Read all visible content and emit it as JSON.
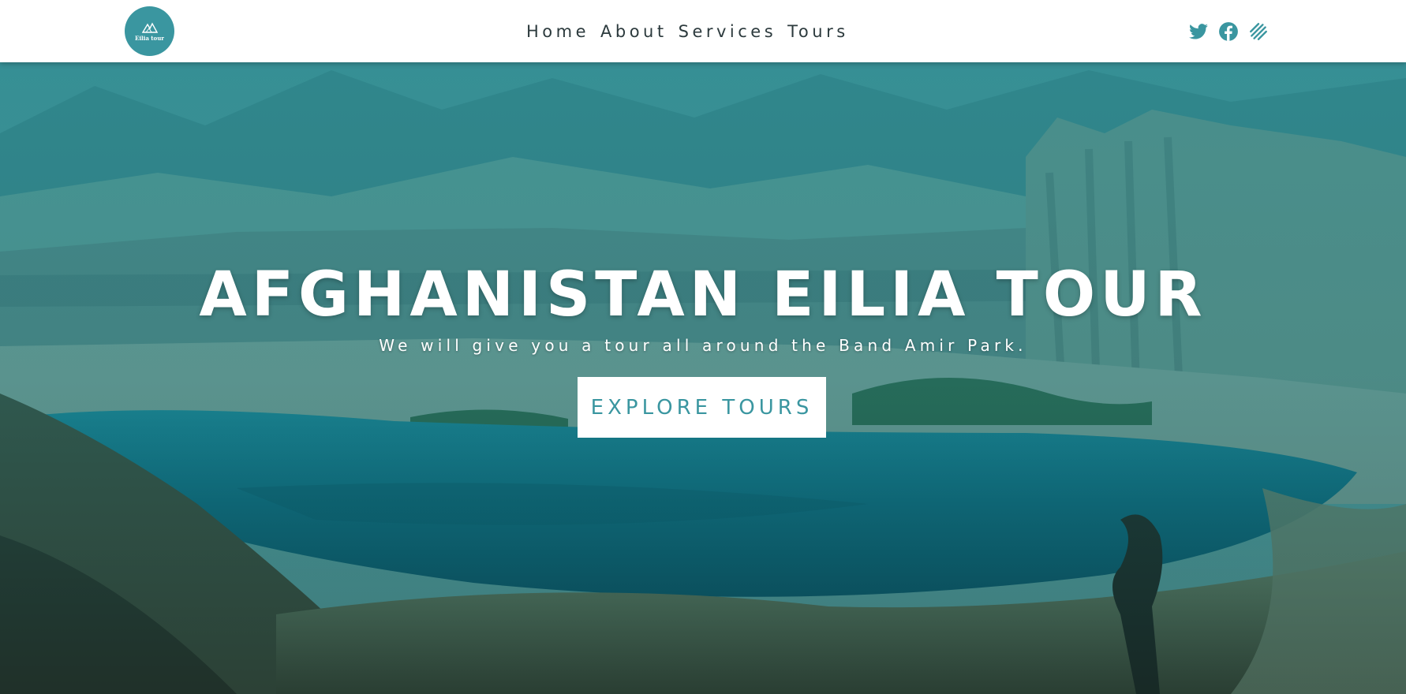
{
  "brand": {
    "logo_text": "Eilia tour",
    "logo_color": "#3a96a0"
  },
  "nav": {
    "items": [
      {
        "label": "Home"
      },
      {
        "label": "About"
      },
      {
        "label": "Services"
      },
      {
        "label": "Tours"
      }
    ]
  },
  "social": {
    "icons": [
      "twitter-icon",
      "facebook-icon",
      "stripe-link-icon"
    ],
    "color": "#3a96a0"
  },
  "hero": {
    "title": "AFGHANISTAN EILIA TOUR",
    "subtitle": "We will give you a tour all around the Band Amir Park.",
    "cta_label": "EXPLORE TOURS",
    "overlay_color": "#1e828c"
  }
}
